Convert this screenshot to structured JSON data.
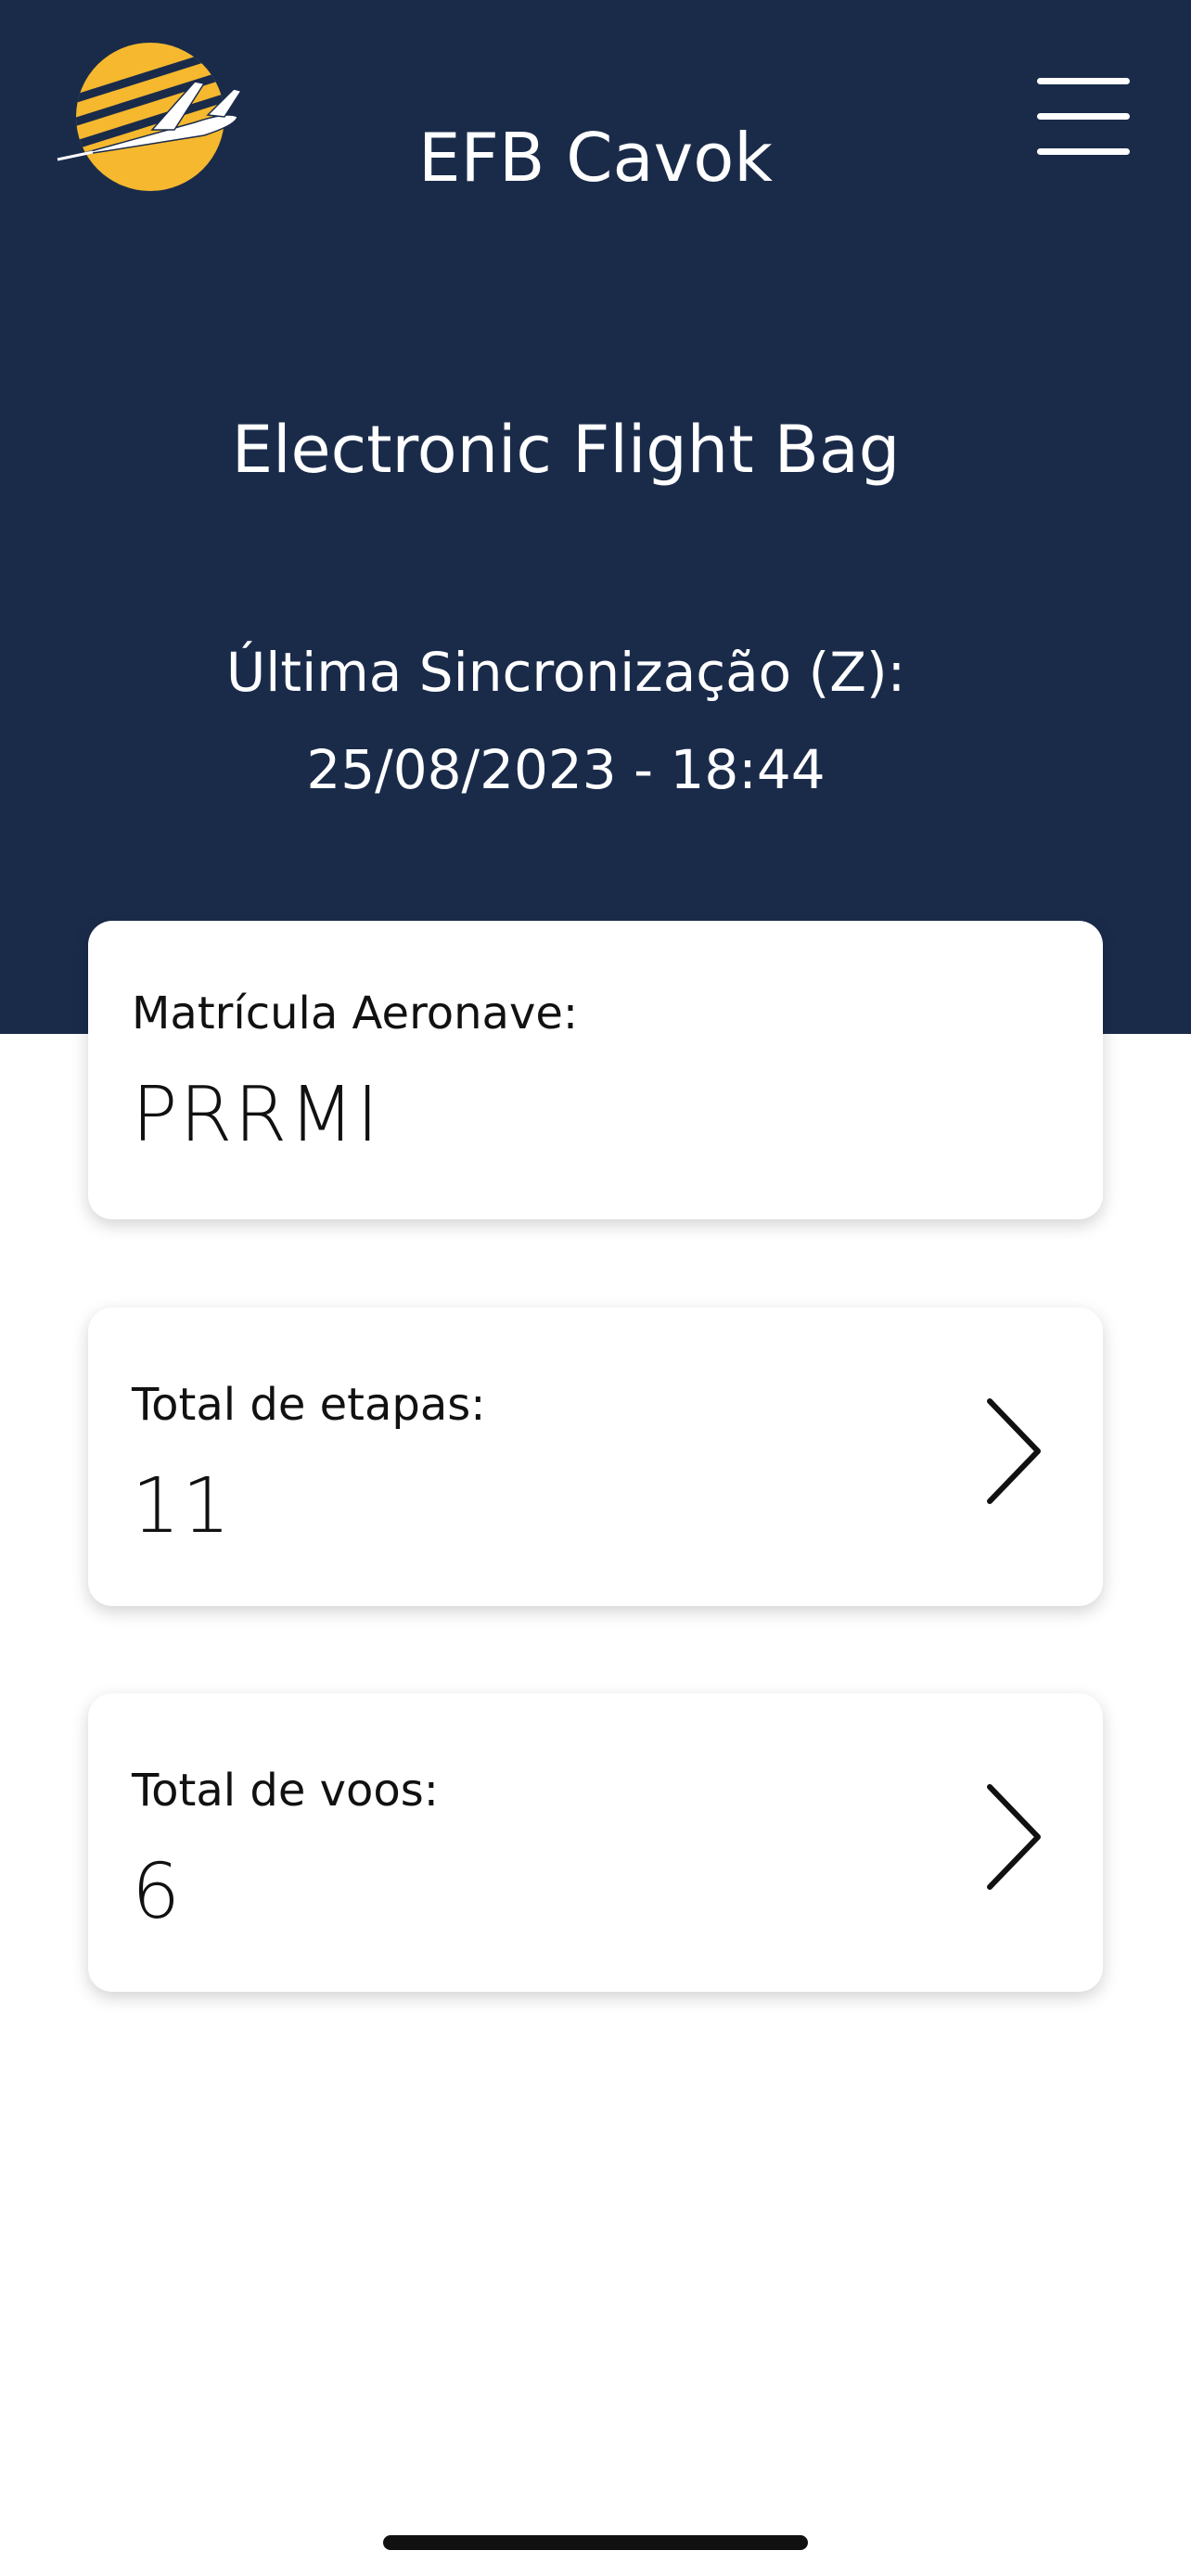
{
  "header": {
    "app_title": "EFB Cavok",
    "subtitle": "Electronic Flight Bag",
    "sync_label": "Última Sincronização (Z):",
    "sync_value": "25/08/2023 - 18:44"
  },
  "cards": [
    {
      "label": "Matrícula Aeronave:",
      "value": "PRRMI"
    },
    {
      "label": "Total de etapas:",
      "value": "11"
    },
    {
      "label": "Total de voos:",
      "value": "6"
    }
  ],
  "icons": {
    "logo": "airplane-sun-logo-icon",
    "menu": "hamburger-menu-icon",
    "chevron": "chevron-right-icon"
  },
  "colors": {
    "header_background": "#1a2b4a",
    "logo_yellow": "#f5b82e",
    "text_dark": "#111111",
    "text_light": "#ffffff"
  }
}
